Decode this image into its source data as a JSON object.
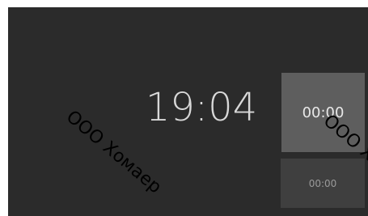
{
  "clock": {
    "time": "19:04"
  },
  "timers": {
    "primary": "00:00",
    "secondary": "00:00"
  },
  "watermark": {
    "text": "ООО Хомаер"
  }
}
